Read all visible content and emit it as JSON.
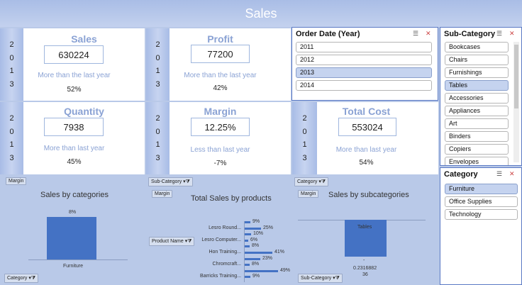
{
  "title": "Sales",
  "kpis": {
    "sales": {
      "year": [
        "2",
        "0",
        "1",
        "3"
      ],
      "title": "Sales",
      "value": "630224",
      "caption": "More than the last year",
      "pct": "52%"
    },
    "profit": {
      "year": [
        "2",
        "0",
        "1",
        "3"
      ],
      "title": "Profit",
      "value": "77200",
      "caption": "More than the last year",
      "pct": "42%"
    },
    "quantity": {
      "year": [
        "2",
        "0",
        "1",
        "3"
      ],
      "title": "Quantity",
      "value": "7938",
      "caption": "More than last year",
      "pct": "45%"
    },
    "margin": {
      "year": [
        "2",
        "0",
        "1",
        "3"
      ],
      "title": "Margin",
      "value": "12.25%",
      "caption": "Less than last year",
      "pct": "-7%"
    },
    "total_cost": {
      "year": [
        "2",
        "0",
        "1",
        "3"
      ],
      "title": "Total Cost",
      "value": "553024",
      "caption": "More than last year",
      "pct": "54%"
    }
  },
  "order_date_slicer": {
    "header": "Order Date (Year)",
    "items": [
      "2011",
      "2012",
      "2013",
      "2014"
    ],
    "selected": "2013"
  },
  "subcategory_slicer": {
    "header": "Sub-Category",
    "items": [
      "Bookcases",
      "Chairs",
      "Furnishings",
      "Tables",
      "Accessories",
      "Appliances",
      "Art",
      "Binders",
      "Copiers",
      "Envelopes"
    ],
    "selected": "Tables"
  },
  "category_slicer": {
    "header": "Category",
    "items": [
      "Furniture",
      "Office Supplies",
      "Technology"
    ],
    "selected": "Furniture"
  },
  "chart_data": [
    {
      "type": "bar",
      "title": "Sales by categories",
      "categories": [
        "Furniture"
      ],
      "values": [
        8
      ],
      "value_labels": [
        "8%"
      ],
      "filter_labels": {
        "values": "Margin",
        "axis": "Category"
      }
    },
    {
      "type": "bar",
      "title": "Total Sales by products",
      "categories": [
        "",
        "Lesro Round...",
        "",
        "Lesro Computer...",
        "",
        "Hon Training...",
        "",
        "Chromcraft...",
        "",
        "Barricks Training..."
      ],
      "values": [
        9,
        25,
        10,
        6,
        8,
        41,
        23,
        8,
        49,
        9
      ],
      "value_labels": [
        "9%",
        "25%",
        "10%",
        "6%",
        "8%",
        "41%",
        "23%",
        "8%",
        "49%",
        "9%"
      ],
      "orientation": "horizontal",
      "filter_labels": {
        "page": "Sub-Category",
        "values": "Margin",
        "axis": "Product Name"
      }
    },
    {
      "type": "bar",
      "title": "Sales by subcategories",
      "categories": [
        "Tables"
      ],
      "values": [
        0.2316882
      ],
      "value_labels": [
        "0.2316882",
        "36"
      ],
      "inner_label": "Tables",
      "filter_labels": {
        "page": "Category",
        "values": "Margin",
        "axis": "Sub-Category"
      }
    }
  ]
}
